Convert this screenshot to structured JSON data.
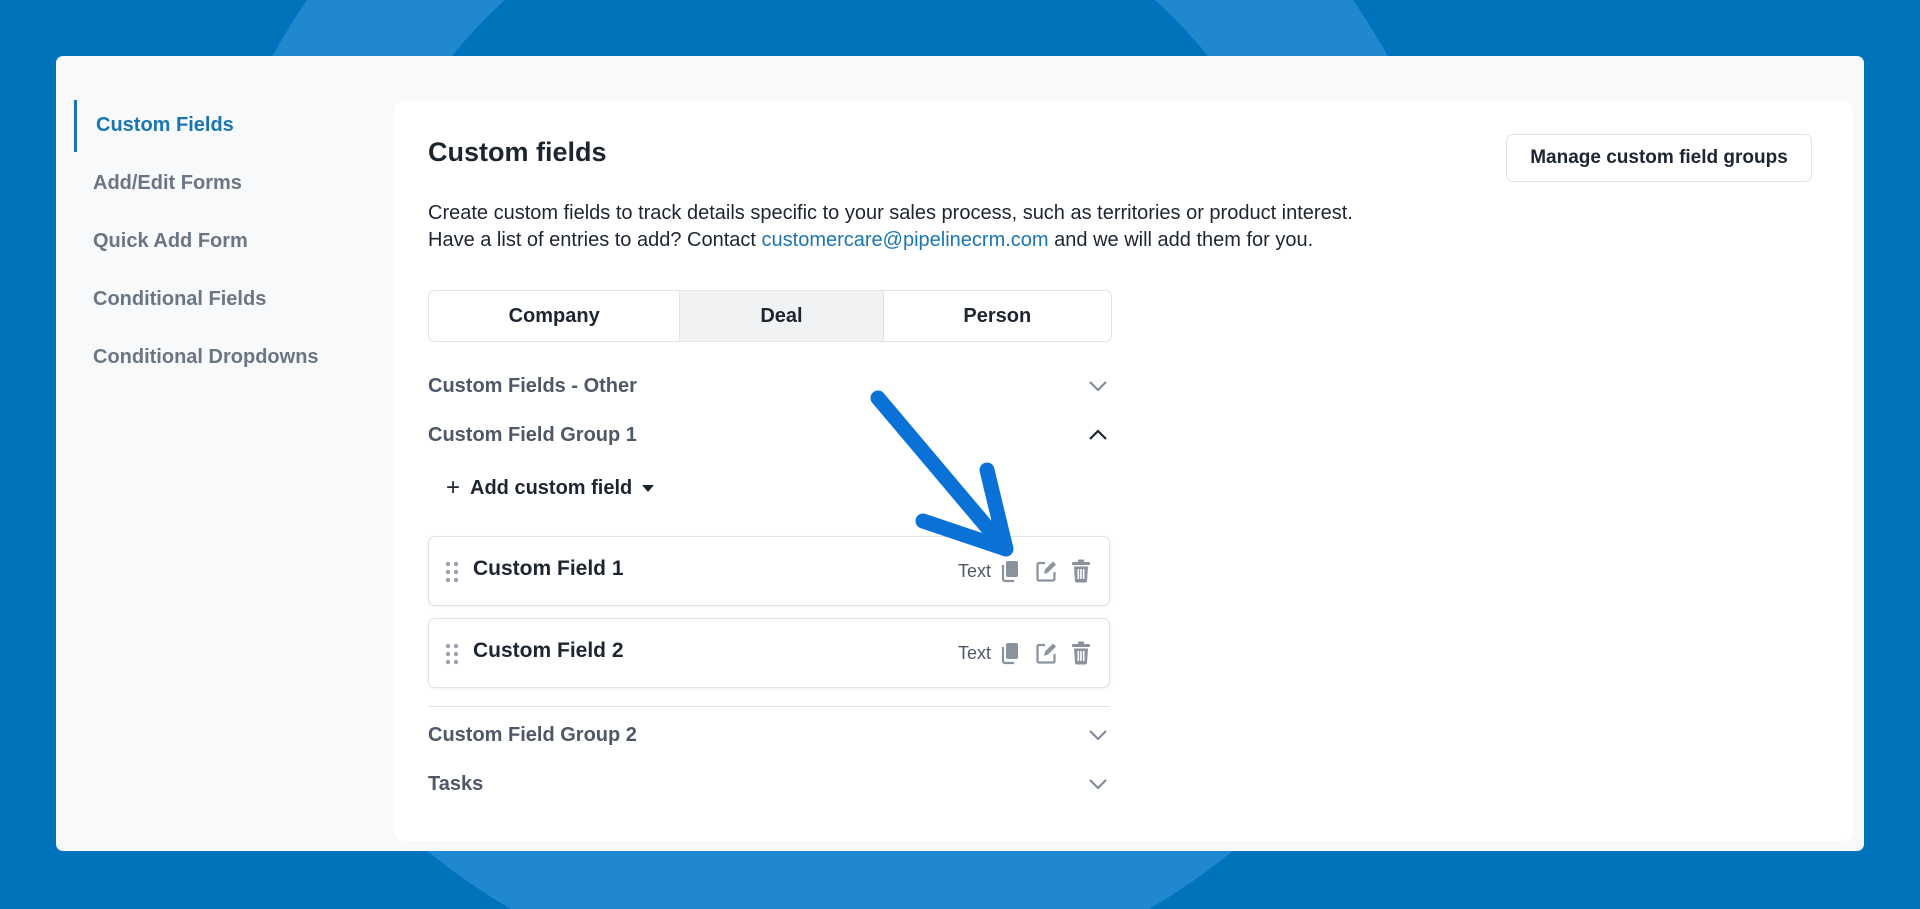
{
  "colors": {
    "background": "#0173bd",
    "accent": "#1a76b3",
    "annotation_arrow": "#0a72d6"
  },
  "sidebar": {
    "items": [
      {
        "label": "Custom Fields",
        "active": true
      },
      {
        "label": "Add/Edit Forms",
        "active": false
      },
      {
        "label": "Quick Add Form",
        "active": false
      },
      {
        "label": "Conditional Fields",
        "active": false
      },
      {
        "label": "Conditional Dropdowns",
        "active": false
      }
    ]
  },
  "main": {
    "title": "Custom fields",
    "manage_button": "Manage custom field groups",
    "description_line1": "Create custom fields to track details specific to your sales process, such as territories or product interest.",
    "description_line2_before": "Have a list of entries to add? Contact",
    "email_link": "customercare@pipelinecrm.com",
    "description_line2_after": "and we will add them for you.",
    "tabs": [
      {
        "label": "Company",
        "selected": false
      },
      {
        "label": "Deal",
        "selected": true
      },
      {
        "label": "Person",
        "selected": false
      }
    ],
    "groups": [
      {
        "label": "Custom Fields - Other",
        "expanded": false
      },
      {
        "label": "Custom Field Group 1",
        "expanded": true
      },
      {
        "label": "Custom Field Group 2",
        "expanded": false
      },
      {
        "label": "Tasks",
        "expanded": false
      }
    ],
    "add_field_label": "Add custom field",
    "fields": [
      {
        "name": "Custom Field 1",
        "type": "Text",
        "actions": [
          "copy-icon",
          "edit-icon",
          "trash-icon"
        ]
      },
      {
        "name": "Custom Field 2",
        "type": "Text",
        "actions": [
          "copy-icon",
          "edit-icon",
          "trash-icon"
        ]
      }
    ]
  }
}
